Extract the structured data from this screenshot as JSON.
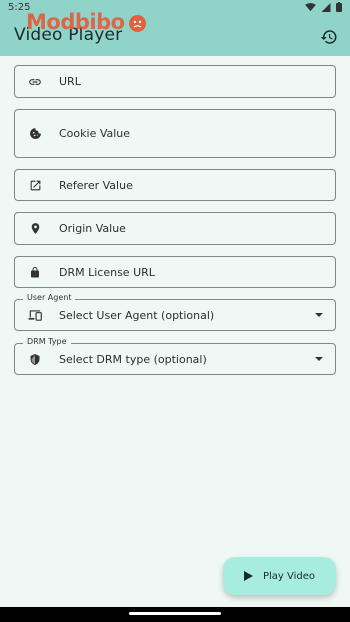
{
  "status_bar": {
    "time": "5:25"
  },
  "app_bar": {
    "title": "Video Player",
    "watermark": "Modbibo"
  },
  "form": {
    "url": {
      "label": "URL",
      "icon": "link-icon"
    },
    "cookie": {
      "label": "Cookie Value",
      "icon": "cookie-icon"
    },
    "referer": {
      "label": "Referer Value",
      "icon": "open-in-new-icon"
    },
    "origin": {
      "label": "Origin Value",
      "icon": "location-pin-icon"
    },
    "drm_license": {
      "label": "DRM License URL",
      "icon": "lock-icon"
    },
    "user_agent": {
      "legend": "User Agent",
      "value": "Select User Agent (optional)",
      "icon": "devices-icon"
    },
    "drm_type": {
      "legend": "DRM Type",
      "value": "Select DRM type (optional)",
      "icon": "shield-icon"
    }
  },
  "fab": {
    "label": "Play Video",
    "icon": "play-icon"
  },
  "colors": {
    "app_bar": "#8fd3c9",
    "fab": "#a6ede0",
    "background": "#f0f8f6",
    "watermark": "#e0623f"
  }
}
